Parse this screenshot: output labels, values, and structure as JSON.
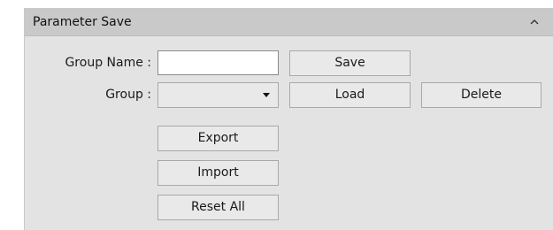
{
  "panel": {
    "title": "Parameter Save",
    "collapse_icon": "chevron-up-icon"
  },
  "form": {
    "group_name_label": "Group Name :",
    "group_name_value": "",
    "group_label": "Group :",
    "group_selected": "",
    "combo_icon": "dropdown-arrow-icon"
  },
  "buttons": {
    "save": "Save",
    "load": "Load",
    "delete": "Delete",
    "export": "Export",
    "import": "Import",
    "reset_all": "Reset All"
  }
}
